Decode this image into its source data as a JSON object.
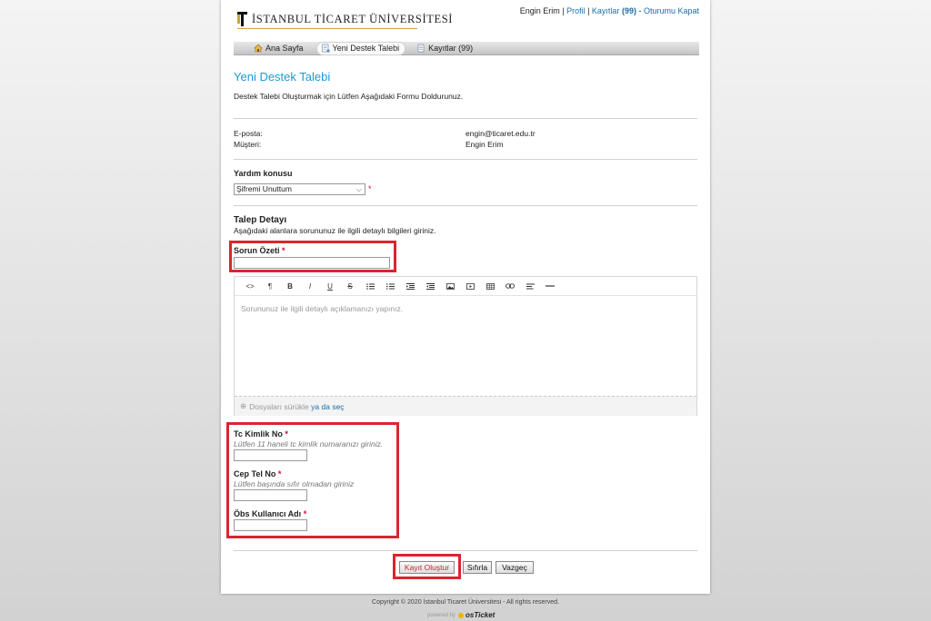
{
  "header": {
    "logo_text": "İSTANBUL TİCARET ÜNİVERSİTESİ",
    "user_name": "Engin Erim",
    "links": {
      "profile": "Profil",
      "records": "Kayıtlar",
      "records_count": "(99)",
      "logout": "Oturumu Kapat"
    }
  },
  "nav": {
    "tabs": [
      {
        "label": "Ana Sayfa",
        "icon": "home-icon"
      },
      {
        "label": "Yeni Destek Talebi",
        "icon": "new-ticket-icon",
        "active": true
      },
      {
        "label": "Kayıtlar (99)",
        "icon": "document-icon"
      }
    ]
  },
  "main": {
    "title": "Yeni Destek Talebi",
    "intro": "Destek Talebi Oluşturmak için Lütfen Aşağıdaki Formu Doldurunuz.",
    "email_label": "E-posta:",
    "email_value": "engin@ticaret.edu.tr",
    "customer_label": "Müşteri:",
    "customer_value": "Engin Erim",
    "help_topic_label": "Yardım konusu",
    "help_topic_value": "Şifremi Unuttum",
    "required_mark": "*",
    "section_title": "Talep Detayı",
    "section_hint": "Aşağıdaki alanlara sorununuz ile ilgili detaylı bilgileri giriniz.",
    "summary_label": "Sorun Özeti",
    "editor_placeholder": "Sorununuz ile ilgili detaylı açıklamanızı yapınız.",
    "dropzone_text": "Dosyaları sürükle",
    "dropzone_link": "ya da seç",
    "tc_label": "Tc Kimlik No",
    "tc_hint": "Lütfen 11 haneli tc kimlik numaranızı giriniz.",
    "phone_label": "Cep Tel No",
    "phone_hint": "Lütfen başında sıfır olmadan giriniz",
    "obs_label": "Öbs Kullanıcı Adı",
    "buttons": {
      "submit": "Kayıt Oluştur",
      "reset": "Sıfırla",
      "cancel": "Vazgeç"
    }
  },
  "footer": {
    "copyright": "Copyright © 2020 İstanbul Ticaret Üniversitesi - All rights reserved.",
    "powered_by": "powered by",
    "brand": "osTicket"
  },
  "colors": {
    "accent": "#1c9ad6",
    "link": "#1a6ea5",
    "highlight_box": "#d8262f",
    "required": "#dd0033"
  }
}
